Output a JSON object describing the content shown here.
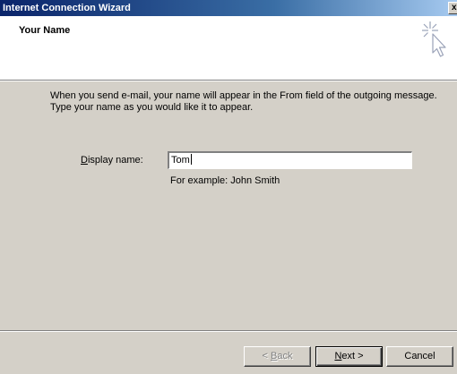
{
  "window": {
    "title": "Internet Connection Wizard",
    "close_label": "x"
  },
  "header": {
    "title": "Your Name",
    "icon": "wizard-cursor-sparkle-icon"
  },
  "body": {
    "intro_line1": "When you send e-mail, your name will appear in the From field of the outgoing message.",
    "intro_line2": "Type your name as you would like it to appear.",
    "display_name": {
      "label_prefix": "",
      "label_accel": "D",
      "label_rest": "isplay name:",
      "value": "Tom",
      "example": "For example: John Smith"
    }
  },
  "buttons": {
    "back": {
      "prefix": "< ",
      "accel": "B",
      "rest": "ack",
      "enabled": false
    },
    "next": {
      "prefix": "",
      "accel": "N",
      "rest": "ext >",
      "enabled": true
    },
    "cancel": {
      "label": "Cancel",
      "enabled": true
    }
  },
  "colors": {
    "title_bar_start": "#0a246a",
    "title_bar_end": "#a6caf0",
    "face": "#d4d0c8",
    "header_bg": "#ffffff"
  }
}
